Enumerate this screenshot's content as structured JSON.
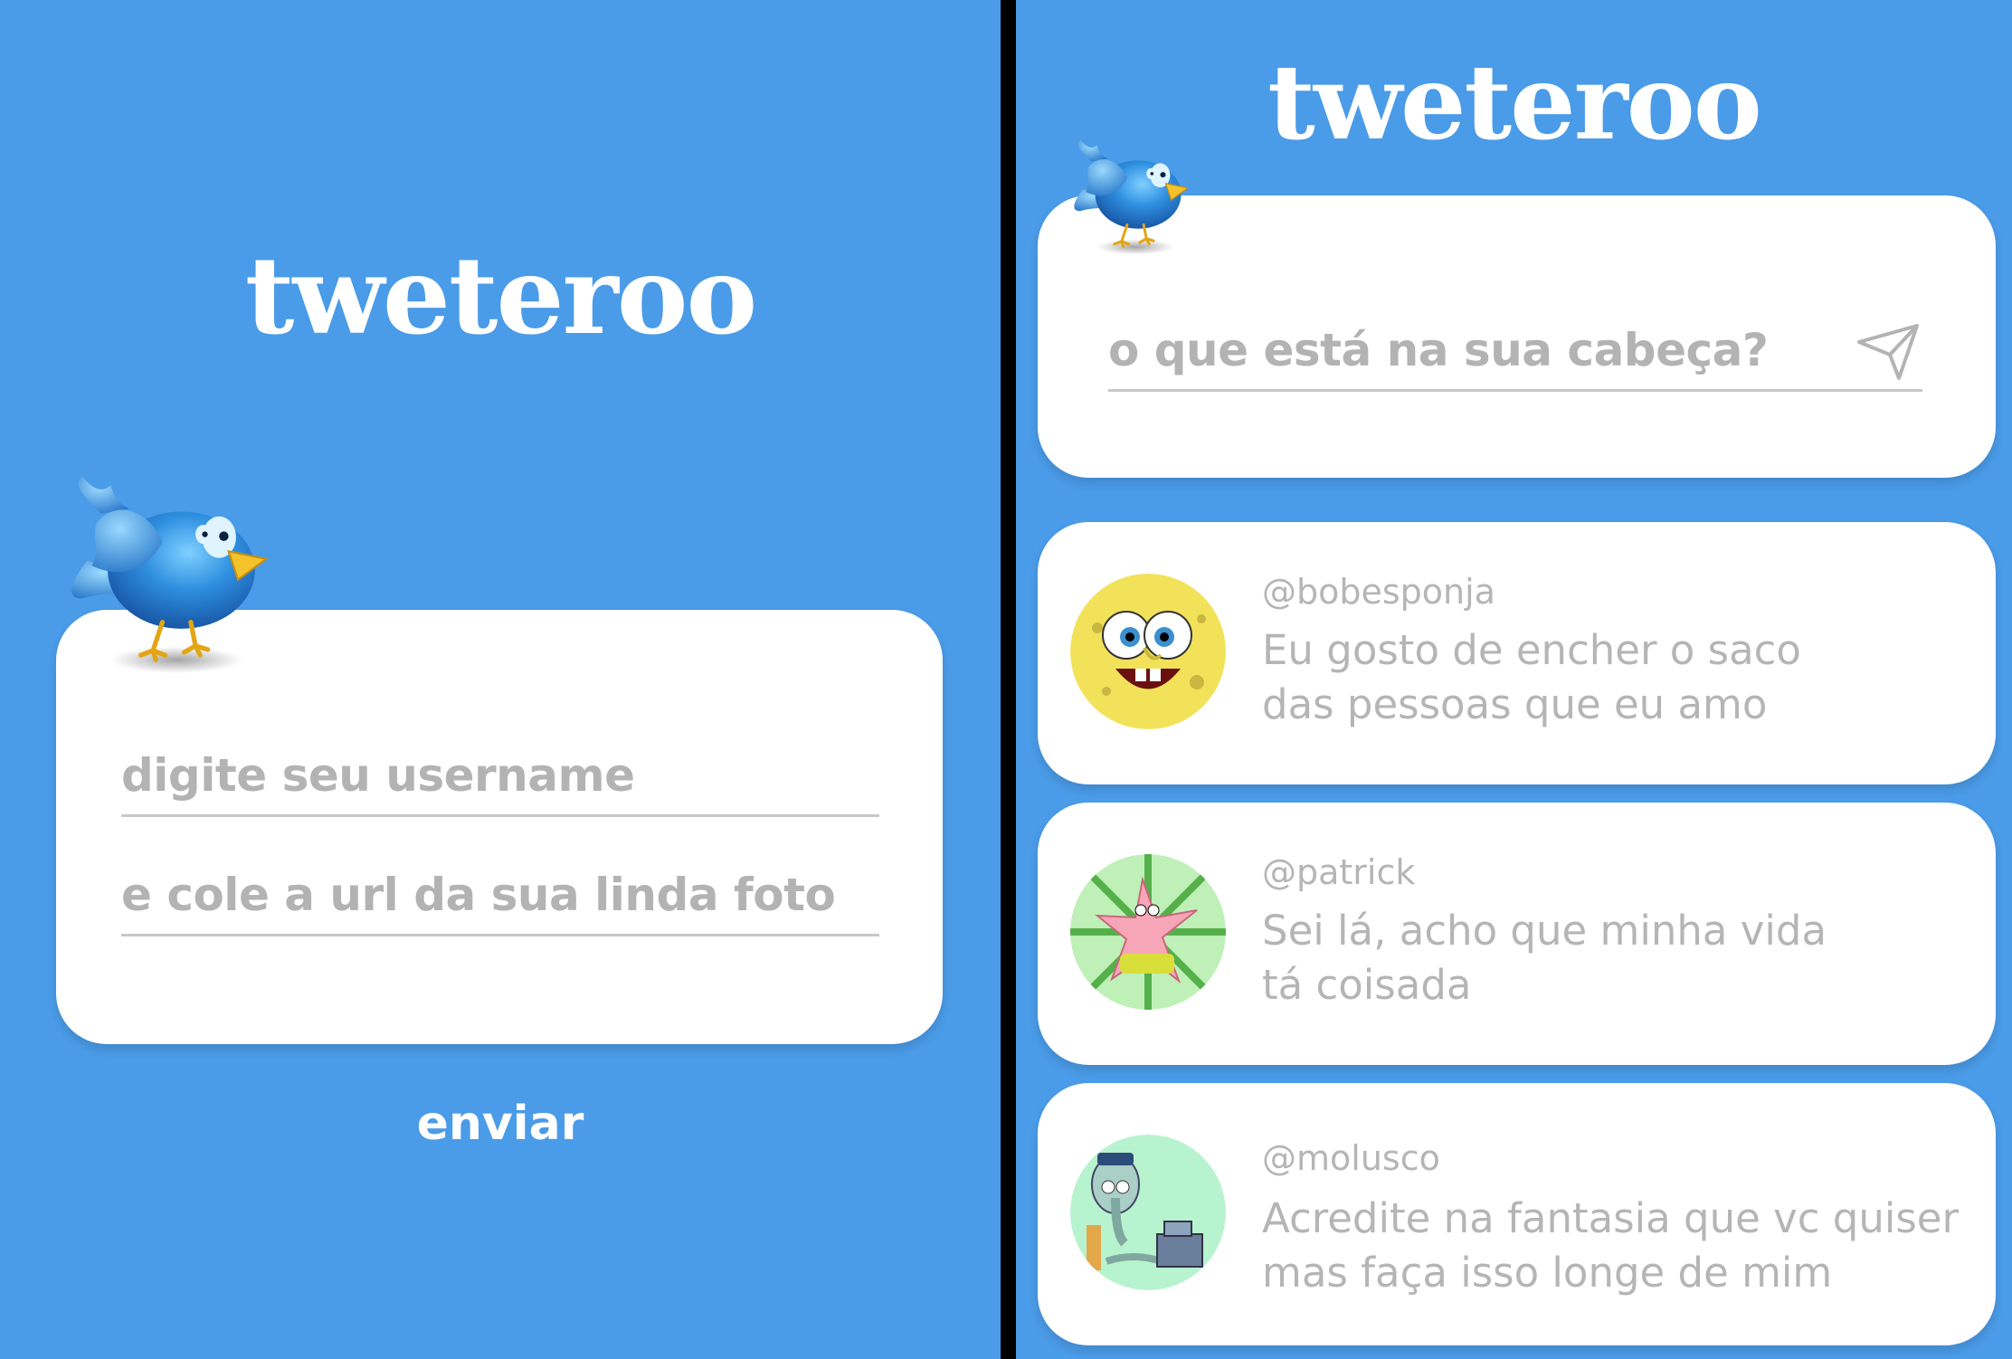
{
  "colors": {
    "background": "#4a9be8",
    "card": "#ffffff",
    "placeholder": "#b3b3b3",
    "title": "#ffffff",
    "divider": "#000000"
  },
  "login": {
    "title": "tweteroo",
    "username_placeholder": "digite seu username",
    "photo_placeholder": "e cole a url da sua linda foto",
    "send_label": "enviar",
    "bird_icon": "bluebird-mascot"
  },
  "feed": {
    "title": "tweteroo",
    "bird_icon": "bluebird-mascot",
    "compose_placeholder": "o que está na sua cabeça?",
    "send_icon": "paper-plane-icon",
    "tweets": [
      {
        "username": "@bobesponja",
        "text_line1": "Eu gosto de encher o saco",
        "text_line2": "das pessoas que eu amo",
        "avatar": "spongebob-avatar"
      },
      {
        "username": "@patrick",
        "text_line1": "Sei lá, acho que minha vida",
        "text_line2": "tá coisada",
        "avatar": "patrick-avatar"
      },
      {
        "username": "@molusco",
        "text_line1": "Acredite na fantasia que vc quiser",
        "text_line2": "mas faça isso longe de mim",
        "avatar": "squidward-avatar"
      }
    ]
  }
}
